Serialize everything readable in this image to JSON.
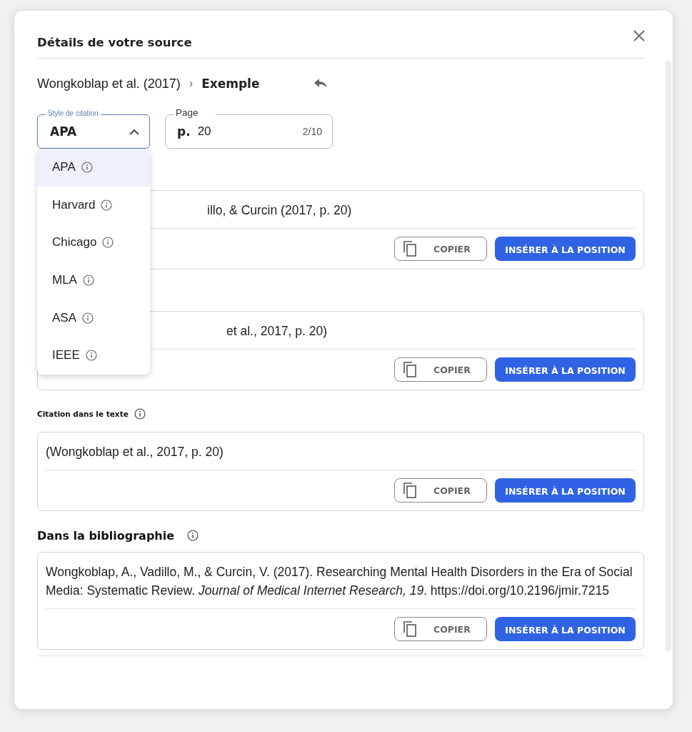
{
  "dialog": {
    "title": "Détails de votre source"
  },
  "breadcrumb": {
    "source": "Wongkoblap et al. (2017)",
    "separator": "›",
    "current": "Exemple"
  },
  "style_field": {
    "label": "Style de citation",
    "value": "APA",
    "expanded": true,
    "options": [
      {
        "label": "APA",
        "selected": true
      },
      {
        "label": "Harvard",
        "selected": false
      },
      {
        "label": "Chicago",
        "selected": false
      },
      {
        "label": "MLA",
        "selected": false
      },
      {
        "label": "ASA",
        "selected": false
      },
      {
        "label": "IEEE",
        "selected": false
      }
    ]
  },
  "page_field": {
    "label": "Page",
    "prefix": "p.",
    "value": "20",
    "counter": "2/10"
  },
  "sections": [
    {
      "kind": "covered",
      "text": "illo, & Curcin (2017, p. 20)",
      "copy": "COPIER",
      "insert": "INSÉRER À LA POSITION"
    },
    {
      "kind": "covered",
      "text": "et al., 2017, p. 20)",
      "copy": "COPIER",
      "insert": "INSÉRER À LA POSITION"
    },
    {
      "kind": "small",
      "heading": "Citation dans le texte",
      "text": "(Wongkoblap et al., 2017, p. 20)",
      "copy": "COPIER",
      "insert": "INSÉRER À LA POSITION"
    },
    {
      "kind": "large",
      "heading": "Dans la bibliographie",
      "text": "Wongkoblap, A., Vadillo, M., & Curcin, V. (2017). Researching Mental Health Disorders in the Era of Social Media: Systematic Review. *Journal of Medical Internet Research, 19*. https://doi.org/10.2196/jmir.7215",
      "copy": "COPIER",
      "insert": "INSÉRER À LA POSITION"
    }
  ]
}
